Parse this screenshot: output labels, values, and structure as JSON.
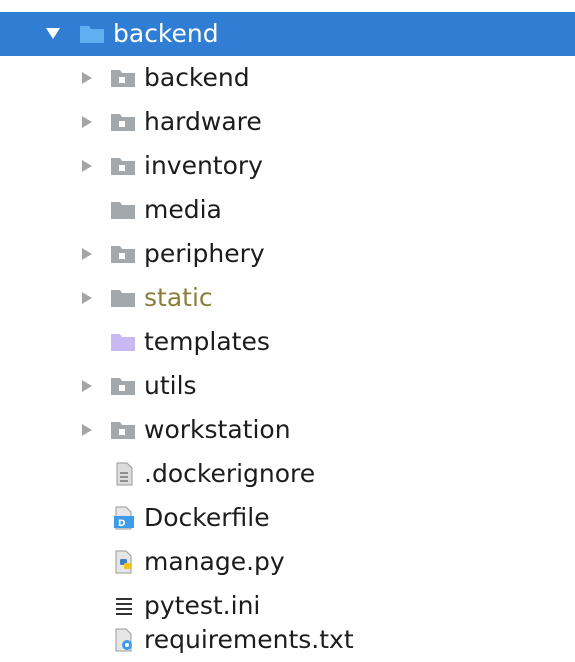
{
  "project_tree": {
    "root": {
      "label": "backend",
      "expanded": true,
      "selected": true,
      "icon": "folder-icon"
    },
    "children": [
      {
        "label": "backend",
        "kind": "package-folder",
        "expandable": true,
        "icon": "package-folder-icon"
      },
      {
        "label": "hardware",
        "kind": "package-folder",
        "expandable": true,
        "icon": "package-folder-icon"
      },
      {
        "label": "inventory",
        "kind": "package-folder",
        "expandable": true,
        "icon": "package-folder-icon"
      },
      {
        "label": "media",
        "kind": "folder",
        "expandable": false,
        "icon": "folder-icon"
      },
      {
        "label": "periphery",
        "kind": "package-folder",
        "expandable": true,
        "icon": "package-folder-icon"
      },
      {
        "label": "static",
        "kind": "resource-folder",
        "expandable": true,
        "icon": "folder-icon",
        "muted": true
      },
      {
        "label": "templates",
        "kind": "template-folder",
        "expandable": false,
        "icon": "templates-folder-icon"
      },
      {
        "label": "utils",
        "kind": "package-folder",
        "expandable": true,
        "icon": "package-folder-icon"
      },
      {
        "label": "workstation",
        "kind": "package-folder",
        "expandable": true,
        "icon": "package-folder-icon"
      },
      {
        "label": ".dockerignore",
        "kind": "file",
        "expandable": false,
        "icon": "text-file-icon"
      },
      {
        "label": "Dockerfile",
        "kind": "file",
        "expandable": false,
        "icon": "docker-file-icon"
      },
      {
        "label": "manage.py",
        "kind": "file",
        "expandable": false,
        "icon": "python-file-icon"
      },
      {
        "label": "pytest.ini",
        "kind": "file",
        "expandable": false,
        "icon": "ini-file-icon"
      },
      {
        "label": "requirements.txt",
        "kind": "file",
        "expandable": false,
        "icon": "requirements-file-icon"
      }
    ]
  },
  "colors": {
    "selection": "#2f7ed4",
    "folder_blue": "#3d9be9",
    "folder_gray": "#a3a8ad",
    "templates_purple": "#c9b8f2",
    "static_text": "#8a7f3a",
    "arrow": "#a6a6a6"
  }
}
